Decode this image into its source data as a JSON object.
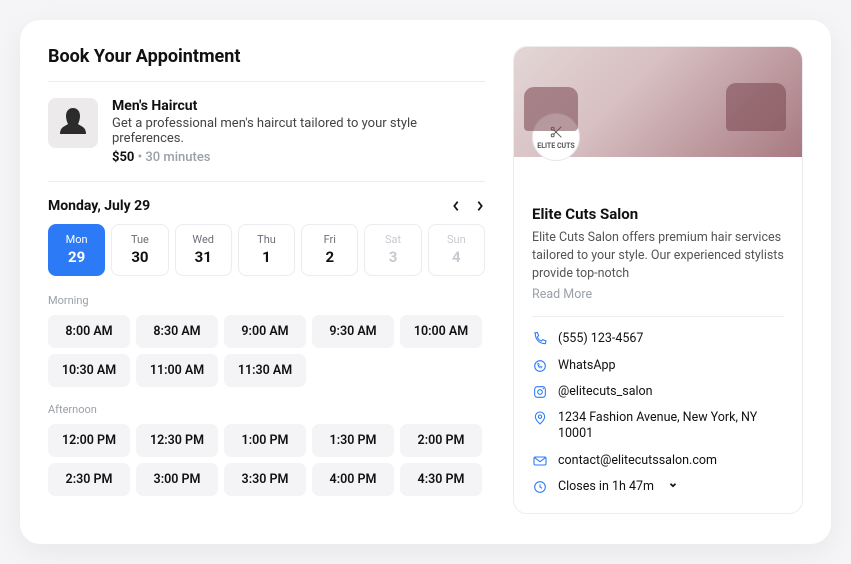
{
  "page_title": "Book Your Appointment",
  "service": {
    "title": "Men's Haircut",
    "description": "Get a professional men's haircut tailored to your style preferences.",
    "price": "$50",
    "separator": " • ",
    "duration": "30 minutes"
  },
  "date": {
    "label": "Monday, July 29",
    "days": [
      {
        "name": "Mon",
        "num": "29",
        "selected": true,
        "disabled": false
      },
      {
        "name": "Tue",
        "num": "30",
        "selected": false,
        "disabled": false
      },
      {
        "name": "Wed",
        "num": "31",
        "selected": false,
        "disabled": false
      },
      {
        "name": "Thu",
        "num": "1",
        "selected": false,
        "disabled": false
      },
      {
        "name": "Fri",
        "num": "2",
        "selected": false,
        "disabled": false
      },
      {
        "name": "Sat",
        "num": "3",
        "selected": false,
        "disabled": true
      },
      {
        "name": "Sun",
        "num": "4",
        "selected": false,
        "disabled": true
      }
    ]
  },
  "sections": {
    "morning": {
      "label": "Morning",
      "slots": [
        "8:00 AM",
        "8:30 AM",
        "9:00 AM",
        "9:30 AM",
        "10:00 AM",
        "10:30 AM",
        "11:00 AM",
        "11:30 AM"
      ]
    },
    "afternoon": {
      "label": "Afternoon",
      "slots": [
        "12:00 PM",
        "12:30 PM",
        "1:00 PM",
        "1:30 PM",
        "2:00 PM",
        "2:30 PM",
        "3:00 PM",
        "3:30 PM",
        "4:00 PM",
        "4:30 PM"
      ]
    }
  },
  "salon": {
    "logo_text": "ELITE CUTS",
    "name": "Elite Cuts Salon",
    "description": "Elite Cuts Salon offers premium hair services tailored to your style. Our experienced stylists provide top-notch",
    "read_more": "Read More",
    "phone": "(555) 123-4567",
    "whatsapp": "WhatsApp",
    "instagram": "@elitecuts_salon",
    "address": "1234 Fashion Avenue, New York, NY 10001",
    "email": "contact@elitecutssalon.com",
    "hours": "Closes in 1h 47m"
  }
}
